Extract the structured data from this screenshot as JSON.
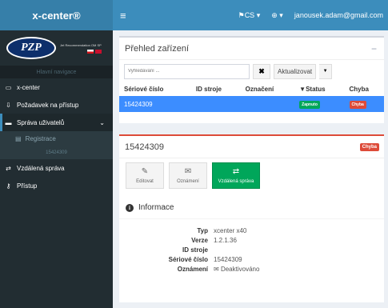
{
  "topbar": {
    "app_title": "x-center®",
    "menu_icon": "hamburger-icon",
    "language": "CS",
    "language_icon": "flag-icon",
    "network_icon": "globe-icon",
    "user_email": "janousek.adam@gmail.com"
  },
  "sidebar": {
    "logo_text": "PZP",
    "logo_subtitle": "Jet Recommendation OM SP",
    "nav_header": "Hlavní navigace",
    "items": [
      {
        "label": "x-center",
        "icon": "monitor-icon"
      },
      {
        "label": "Požadavek na přístup",
        "icon": "download-icon"
      },
      {
        "label": "Správa uživatelů",
        "icon": "user-card-icon"
      },
      {
        "label": "Vzdálená správa",
        "icon": "exchange-icon"
      },
      {
        "label": "Přístup",
        "icon": "key-icon"
      }
    ],
    "submenu": {
      "registrace": "Registrace",
      "serial": "15424309"
    }
  },
  "overview": {
    "title": "Přehled zařízení",
    "search_placeholder": "Vyhledávání ...",
    "refresh_label": "Aktualizovat",
    "columns": [
      "Sériové číslo",
      "ID stroje",
      "Označení",
      "▼Status",
      "Chyba"
    ],
    "rows": [
      {
        "serial": "15424309",
        "machine_id": "",
        "label": "",
        "status": "Zapnuto",
        "error": "Chyba"
      }
    ]
  },
  "detail": {
    "title": "15424309",
    "error_badge": "Chyba",
    "actions": [
      {
        "label": "Editovat",
        "icon": "edit-icon"
      },
      {
        "label": "Oznámení",
        "icon": "envelope-icon"
      },
      {
        "label": "Vzdálená správa",
        "icon": "exchange-icon"
      }
    ],
    "info_title": "Informace",
    "fields": [
      {
        "key": "Typ",
        "value": "xcenter x40"
      },
      {
        "key": "Verze",
        "value": "1.2.1.36"
      },
      {
        "key": "ID stroje",
        "value": ""
      },
      {
        "key": "Sériové číslo",
        "value": "15424309"
      },
      {
        "key": "Oznámení",
        "value": "Deaktivováno"
      }
    ]
  },
  "colors": {
    "primary": "#3c8dbc",
    "sidebar": "#222d32",
    "success": "#00a65a",
    "danger": "#dd4b39",
    "selected_row": "#3c8dff"
  }
}
